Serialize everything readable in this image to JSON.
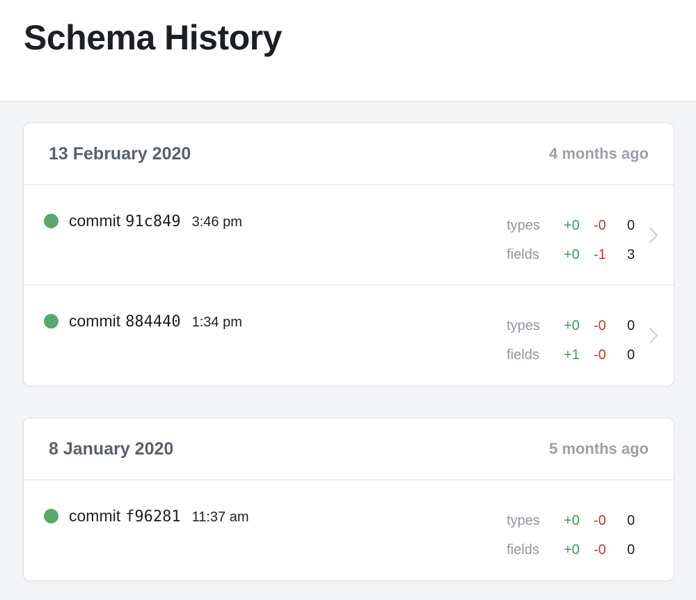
{
  "page": {
    "title": "Schema History"
  },
  "labels": {
    "commit": "commit",
    "types": "types",
    "fields": "fields"
  },
  "colors": {
    "status_dot": "#58a86b",
    "added": "#3f9a56",
    "removed": "#c0392b"
  },
  "icons": {
    "status": "status-dot-icon",
    "chevron": "chevron-right-icon"
  },
  "groups": [
    {
      "date": "13 February 2020",
      "relative": "4 months ago",
      "commits": [
        {
          "hash": "91c849",
          "time": "3:46 pm",
          "types": {
            "added": "+0",
            "removed": "-0",
            "changed": "0"
          },
          "fields": {
            "added": "+0",
            "removed": "-1",
            "changed": "3"
          }
        },
        {
          "hash": "884440",
          "time": "1:34 pm",
          "types": {
            "added": "+0",
            "removed": "-0",
            "changed": "0"
          },
          "fields": {
            "added": "+1",
            "removed": "-0",
            "changed": "0"
          }
        }
      ]
    },
    {
      "date": "8 January 2020",
      "relative": "5 months ago",
      "commits": [
        {
          "hash": "f96281",
          "time": "11:37 am",
          "types": {
            "added": "+0",
            "removed": "-0",
            "changed": "0"
          },
          "fields": {
            "added": "+0",
            "removed": "-0",
            "changed": "0"
          }
        }
      ]
    }
  ]
}
